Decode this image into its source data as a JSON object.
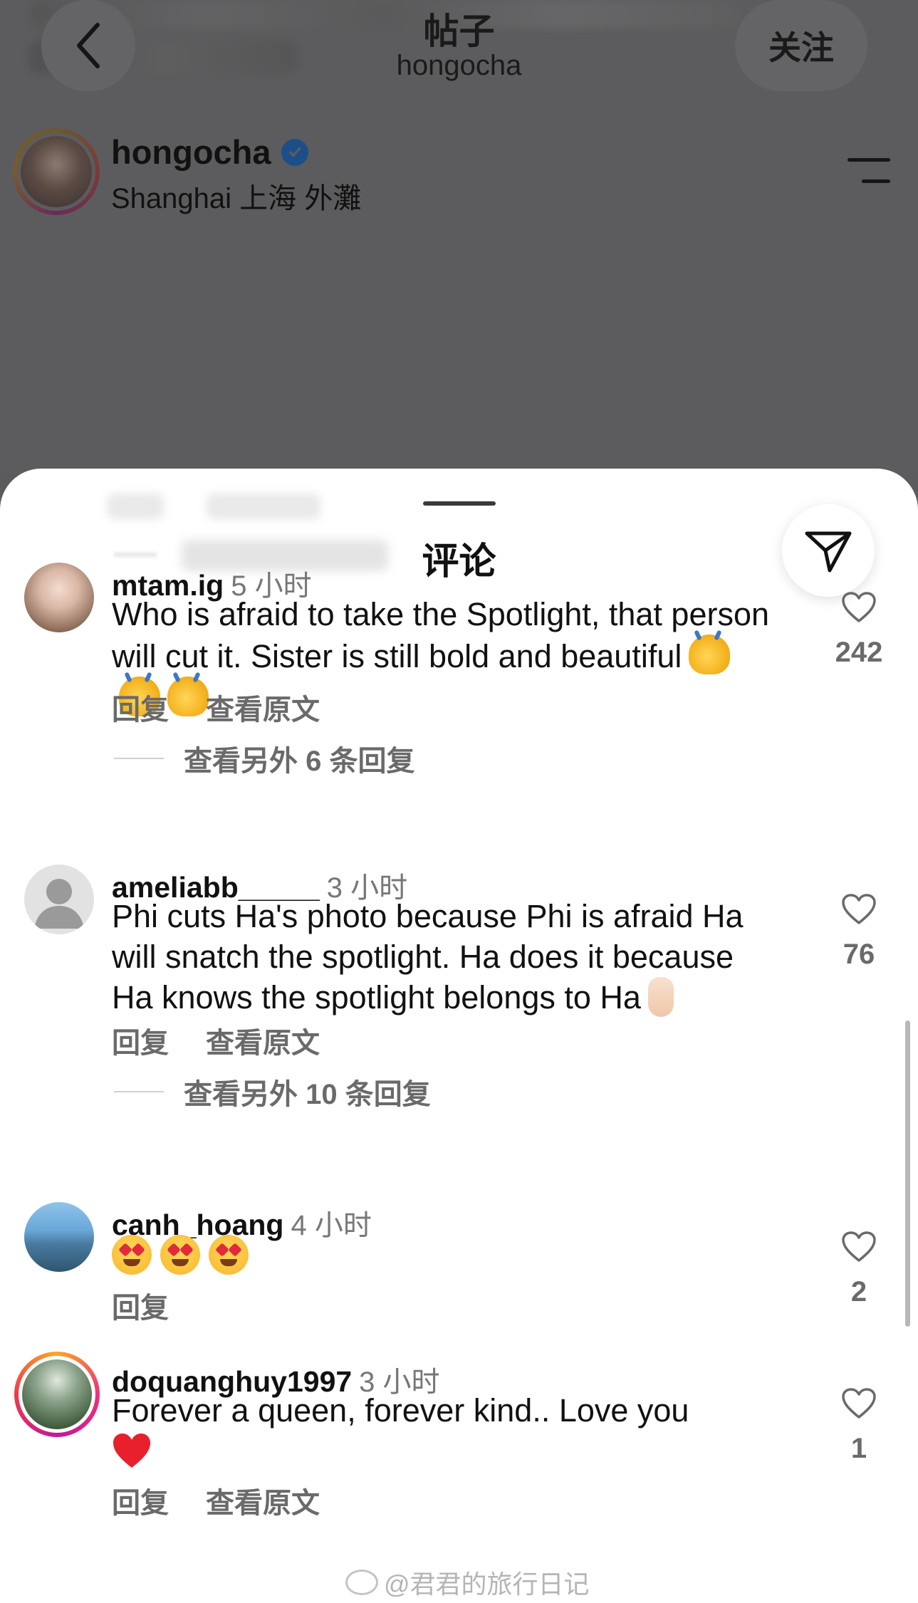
{
  "header": {
    "title": "帖子",
    "subtitle": "hongocha",
    "follow_label": "关注"
  },
  "post": {
    "author": "hongocha",
    "location": "Shanghai 上海 外灘"
  },
  "comments_sheet": {
    "title": "评论"
  },
  "comments": [
    {
      "user": "mtam.ig",
      "time": "5 小时",
      "text": "Who is afraid to take the Spotlight, that person will cut it. Sister is still bold and beautiful",
      "emoji": "clapping-hands x3",
      "likes": "242",
      "reply_label": "回复",
      "translate_label": "查看原文",
      "view_replies": "查看另外 6 条回复"
    },
    {
      "user": "ameliabb_____",
      "time": "3 小时",
      "text": "Phi cuts Ha's photo because Phi is afraid Ha will snatch the spotlight. Ha does it because Ha knows the spotlight belongs to Ha",
      "emoji": "crossed-fingers",
      "likes": "76",
      "reply_label": "回复",
      "translate_label": "查看原文",
      "view_replies": "查看另外 10 条回复"
    },
    {
      "user": "canh_hoang",
      "time": "4 小时",
      "emoji": "heart-eyes x3",
      "likes": "2",
      "reply_label": "回复"
    },
    {
      "user": "doquanghuy1997",
      "time": "3 小时",
      "text": "Forever a queen, forever kind.. Love you",
      "emoji": "red-heart",
      "likes": "1",
      "reply_label": "回复",
      "translate_label": "查看原文"
    }
  ],
  "watermark": "@君君的旅行日记",
  "icons": {
    "back": "chevron-left-icon",
    "verified": "verified-badge-icon",
    "menu": "menu-icon",
    "send": "send-icon",
    "like": "heart-outline-icon"
  },
  "colors": {
    "dim_background": "#5c5c5e",
    "sheet": "#ffffff",
    "verified": "#1c4f87",
    "muted_text": "#6a6a6a"
  }
}
